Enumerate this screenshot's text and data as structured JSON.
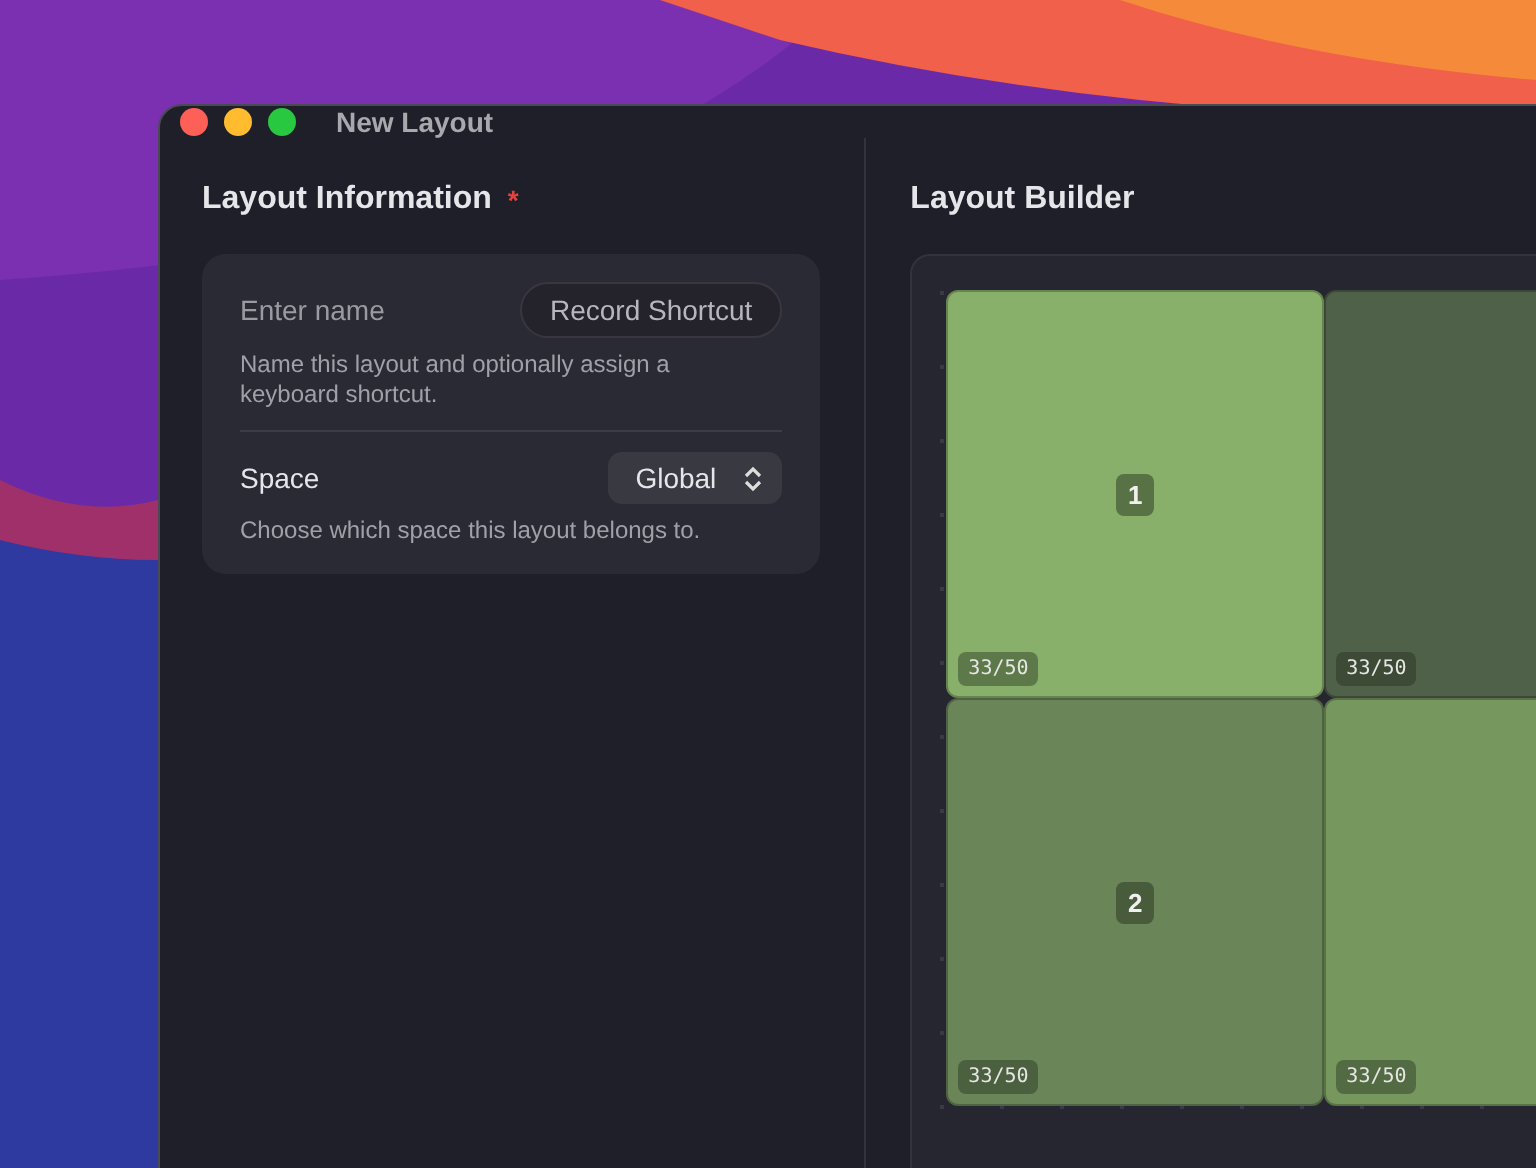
{
  "window": {
    "title": "New Layout"
  },
  "layout_information": {
    "title": "Layout Information",
    "required_mark": "*",
    "name_field": {
      "placeholder": "Enter name"
    },
    "shortcut_button": "Record Shortcut",
    "name_hint": "Name this layout and optionally assign a keyboard shortcut.",
    "space_label": "Space",
    "space_value": "Global",
    "space_hint": "Choose which space this layout belongs to."
  },
  "layout_builder": {
    "title": "Layout Builder",
    "tiles": [
      {
        "number": "1",
        "ratio": "33/50",
        "color": "#88b06a"
      },
      {
        "ratio": "33/50",
        "color": "#50614a"
      },
      {
        "number": "2",
        "ratio": "33/50",
        "color": "#6a8558"
      },
      {
        "ratio": "33/50",
        "color": "#76985e"
      }
    ]
  }
}
